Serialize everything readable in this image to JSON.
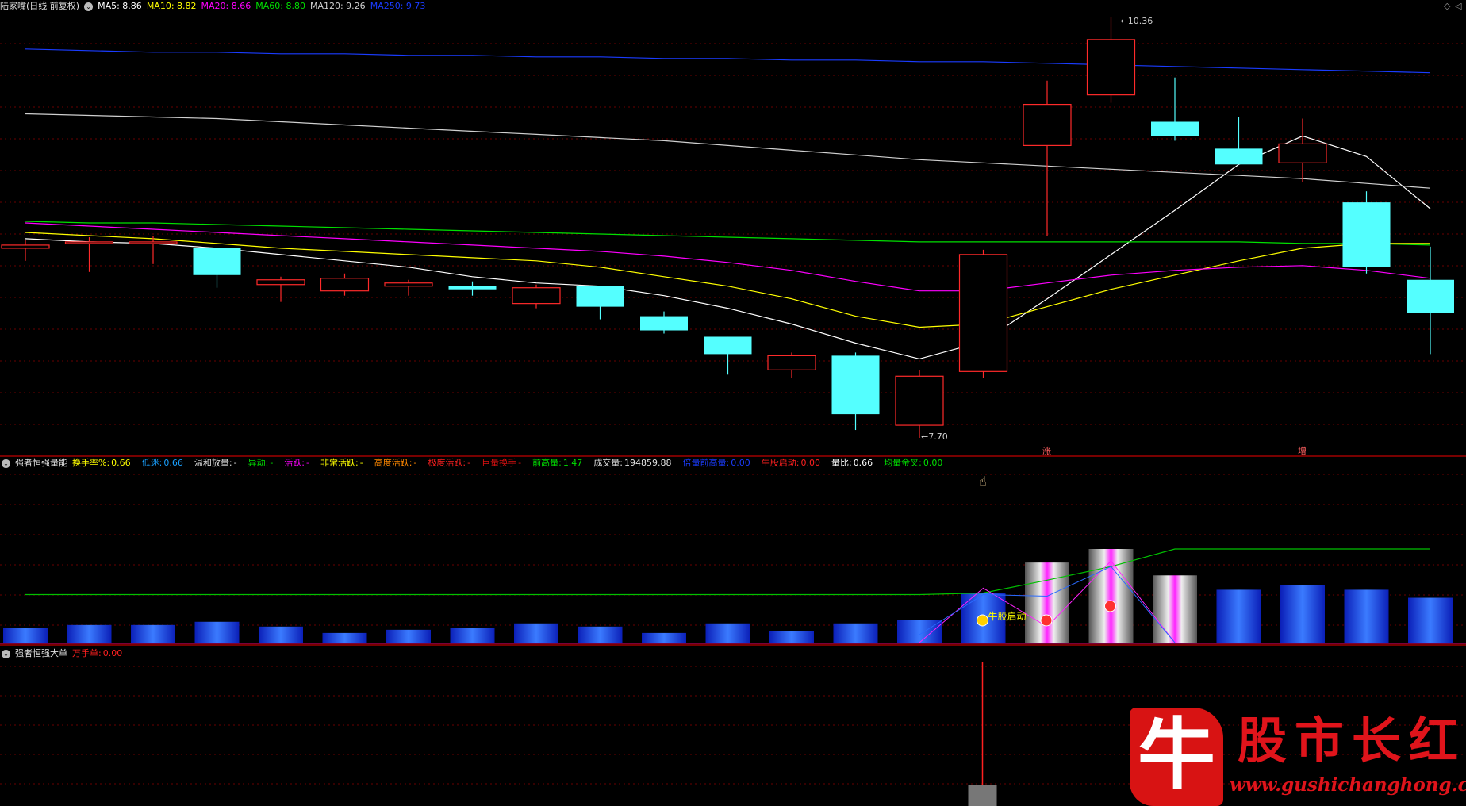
{
  "main_header": {
    "title": "陆家嘴(日线 前复权)",
    "ma5": {
      "text": "MA5: 8.86",
      "color": "#ffffff"
    },
    "ma10": {
      "text": "MA10: 8.82",
      "color": "#ffff00"
    },
    "ma20": {
      "text": "MA20: 8.66",
      "color": "#ff00ff"
    },
    "ma60": {
      "text": "MA60: 8.80",
      "color": "#00e000"
    },
    "ma120": {
      "text": "MA120: 9.26",
      "color": "#d0d0d0"
    },
    "ma250": {
      "text": "MA250: 9.73",
      "color": "#1a3cff"
    }
  },
  "volume_header": {
    "title": "强者恒强量能",
    "items": [
      {
        "label": "换手率%:",
        "value": "0.66",
        "label_color": "#ffff00",
        "value_color": "#ffff00"
      },
      {
        "label": "低迷:",
        "value": "0.66",
        "label_color": "#19a0ff",
        "value_color": "#19a0ff"
      },
      {
        "label": "温和放量:",
        "value": "-",
        "label_color": "#e0e0e0",
        "value_color": "#e0e0e0"
      },
      {
        "label": "异动:",
        "value": "-",
        "label_color": "#00e000",
        "value_color": "#00e000"
      },
      {
        "label": "活跃:",
        "value": "-",
        "label_color": "#ff00ff",
        "value_color": "#ff00ff"
      },
      {
        "label": "非常活跃:",
        "value": "-",
        "label_color": "#ffff00",
        "value_color": "#ffff00"
      },
      {
        "label": "高度活跃:",
        "value": "-",
        "label_color": "#ff8800",
        "value_color": "#ff8800"
      },
      {
        "label": "极度活跃:",
        "value": "-",
        "label_color": "#ff2020",
        "value_color": "#ff2020"
      },
      {
        "label": "巨量换手",
        "value": "-",
        "label_color": "#dd1111",
        "value_color": "#dd1111"
      },
      {
        "label": "前高量:",
        "value": "1.47",
        "label_color": "#00e000",
        "value_color": "#00e000"
      },
      {
        "label": "成交量:",
        "value": "194859.88",
        "label_color": "#e0e0e0",
        "value_color": "#e0e0e0"
      },
      {
        "label": "倍量前高量:",
        "value": "0.00",
        "label_color": "#1a3cff",
        "value_color": "#1a3cff"
      },
      {
        "label": "牛股启动:",
        "value": "0.00",
        "label_color": "#ff2020",
        "value_color": "#ff2020"
      },
      {
        "label": "量比:",
        "value": "0.66",
        "label_color": "#ffffff",
        "value_color": "#ffffff"
      },
      {
        "label": "均量金叉:",
        "value": "0.00",
        "label_color": "#00e000",
        "value_color": "#00e000"
      }
    ]
  },
  "bigorder_header": {
    "title": "强者恒强大单",
    "items": [
      {
        "label": "万手单:",
        "value": "0.00",
        "label_color": "#ff2020",
        "value_color": "#ff2020"
      }
    ]
  },
  "annotations": {
    "high": "10.36",
    "low": "7.70",
    "bull_start": "牛股启动",
    "marker_zhang": "涨",
    "marker_zeng": "增"
  },
  "colors": {
    "up": "#ff2a2a",
    "down": "#54ffff",
    "grid": "#6a0000",
    "divider": "#a00000"
  },
  "chart_data": {
    "type": "candlestick",
    "price_range": [
      7.7,
      10.36
    ],
    "candles": [
      {
        "o": 8.9,
        "h": 8.95,
        "l": 8.82,
        "c": 8.92
      },
      {
        "o": 8.93,
        "h": 8.97,
        "l": 8.75,
        "c": 8.94
      },
      {
        "o": 8.93,
        "h": 8.98,
        "l": 8.8,
        "c": 8.94
      },
      {
        "o": 8.9,
        "h": 8.9,
        "l": 8.65,
        "c": 8.73
      },
      {
        "o": 8.67,
        "h": 8.72,
        "l": 8.56,
        "c": 8.7
      },
      {
        "o": 8.63,
        "h": 8.74,
        "l": 8.6,
        "c": 8.71
      },
      {
        "o": 8.66,
        "h": 8.7,
        "l": 8.6,
        "c": 8.68
      },
      {
        "o": 8.66,
        "h": 8.69,
        "l": 8.6,
        "c": 8.64
      },
      {
        "o": 8.55,
        "h": 8.67,
        "l": 8.52,
        "c": 8.65
      },
      {
        "o": 8.66,
        "h": 8.66,
        "l": 8.45,
        "c": 8.53
      },
      {
        "o": 8.47,
        "h": 8.5,
        "l": 8.36,
        "c": 8.38
      },
      {
        "o": 8.34,
        "h": 8.34,
        "l": 8.1,
        "c": 8.23
      },
      {
        "o": 8.13,
        "h": 8.24,
        "l": 8.08,
        "c": 8.22
      },
      {
        "o": 8.22,
        "h": 8.24,
        "l": 7.75,
        "c": 7.85
      },
      {
        "o": 7.78,
        "h": 8.13,
        "l": 7.7,
        "c": 8.09
      },
      {
        "o": 8.12,
        "h": 8.89,
        "l": 8.08,
        "c": 8.86
      },
      {
        "o": 9.55,
        "h": 9.96,
        "l": 8.98,
        "c": 9.81
      },
      {
        "o": 9.87,
        "h": 10.36,
        "l": 9.82,
        "c": 10.22
      },
      {
        "o": 9.7,
        "h": 9.98,
        "l": 9.58,
        "c": 9.61
      },
      {
        "o": 9.53,
        "h": 9.73,
        "l": 9.5,
        "c": 9.43
      },
      {
        "o": 9.44,
        "h": 9.72,
        "l": 9.32,
        "c": 9.56
      },
      {
        "o": 9.19,
        "h": 9.26,
        "l": 8.74,
        "c": 8.78
      },
      {
        "o": 8.7,
        "h": 8.91,
        "l": 8.23,
        "c": 8.49
      }
    ],
    "ma_series": [
      {
        "name": "MA5",
        "color": "#ffffff",
        "values": [
          8.96,
          8.94,
          8.93,
          8.9,
          8.86,
          8.82,
          8.78,
          8.72,
          8.68,
          8.66,
          8.6,
          8.52,
          8.42,
          8.3,
          8.2,
          8.31,
          8.58,
          8.86,
          9.14,
          9.43,
          9.61,
          9.48,
          9.15
        ]
      },
      {
        "name": "MA10",
        "color": "#ffff00",
        "values": [
          9.0,
          8.98,
          8.96,
          8.93,
          8.9,
          8.88,
          8.86,
          8.84,
          8.82,
          8.78,
          8.72,
          8.66,
          8.58,
          8.47,
          8.4,
          8.42,
          8.53,
          8.64,
          8.73,
          8.82,
          8.9,
          8.93,
          8.93
        ]
      },
      {
        "name": "MA20",
        "color": "#ff00ff",
        "values": [
          9.06,
          9.04,
          9.02,
          9.0,
          8.98,
          8.96,
          8.94,
          8.92,
          8.9,
          8.88,
          8.85,
          8.81,
          8.76,
          8.69,
          8.63,
          8.63,
          8.68,
          8.73,
          8.76,
          8.78,
          8.79,
          8.76,
          8.71
        ]
      },
      {
        "name": "MA60",
        "color": "#00e000",
        "values": [
          9.07,
          9.06,
          9.06,
          9.05,
          9.04,
          9.03,
          9.02,
          9.01,
          9.0,
          8.99,
          8.98,
          8.97,
          8.96,
          8.95,
          8.94,
          8.94,
          8.94,
          8.94,
          8.94,
          8.94,
          8.93,
          8.93,
          8.92
        ]
      },
      {
        "name": "MA120",
        "color": "#d0d0d0",
        "values": [
          9.75,
          9.74,
          9.73,
          9.72,
          9.7,
          9.68,
          9.66,
          9.64,
          9.62,
          9.6,
          9.58,
          9.55,
          9.52,
          9.49,
          9.46,
          9.44,
          9.42,
          9.4,
          9.38,
          9.36,
          9.34,
          9.31,
          9.28
        ]
      },
      {
        "name": "MA250",
        "color": "#1a3cff",
        "values": [
          10.16,
          10.15,
          10.14,
          10.14,
          10.13,
          10.13,
          10.12,
          10.12,
          10.11,
          10.11,
          10.1,
          10.1,
          10.09,
          10.09,
          10.08,
          10.08,
          10.07,
          10.06,
          10.05,
          10.04,
          10.03,
          10.02,
          10.01
        ]
      }
    ],
    "volume": {
      "values": [
        0.18,
        0.22,
        0.22,
        0.26,
        0.2,
        0.12,
        0.16,
        0.18,
        0.24,
        0.2,
        0.12,
        0.24,
        0.14,
        0.24,
        0.28,
        0.62,
        1.0,
        1.17,
        0.84,
        0.66,
        0.72,
        0.66,
        0.56
      ],
      "styles": [
        "blue",
        "blue",
        "blue",
        "blue",
        "blue",
        "blue",
        "blue",
        "blue",
        "blue",
        "blue",
        "blue",
        "blue",
        "blue",
        "blue",
        "blue",
        "blue",
        "gray-magenta",
        "gray-magenta",
        "gray-magenta",
        "blue",
        "blue",
        "blue",
        "blue"
      ],
      "prev_high_line": [
        0.6,
        0.6,
        0.6,
        0.6,
        0.6,
        0.6,
        0.6,
        0.6,
        0.6,
        0.6,
        0.6,
        0.6,
        0.6,
        0.6,
        0.6,
        0.62,
        0.78,
        0.95,
        1.17,
        1.17,
        1.17,
        1.17,
        1.17
      ],
      "signal_bars": [
        15,
        16,
        17
      ]
    },
    "big_order": {
      "spike_index": 15
    }
  }
}
